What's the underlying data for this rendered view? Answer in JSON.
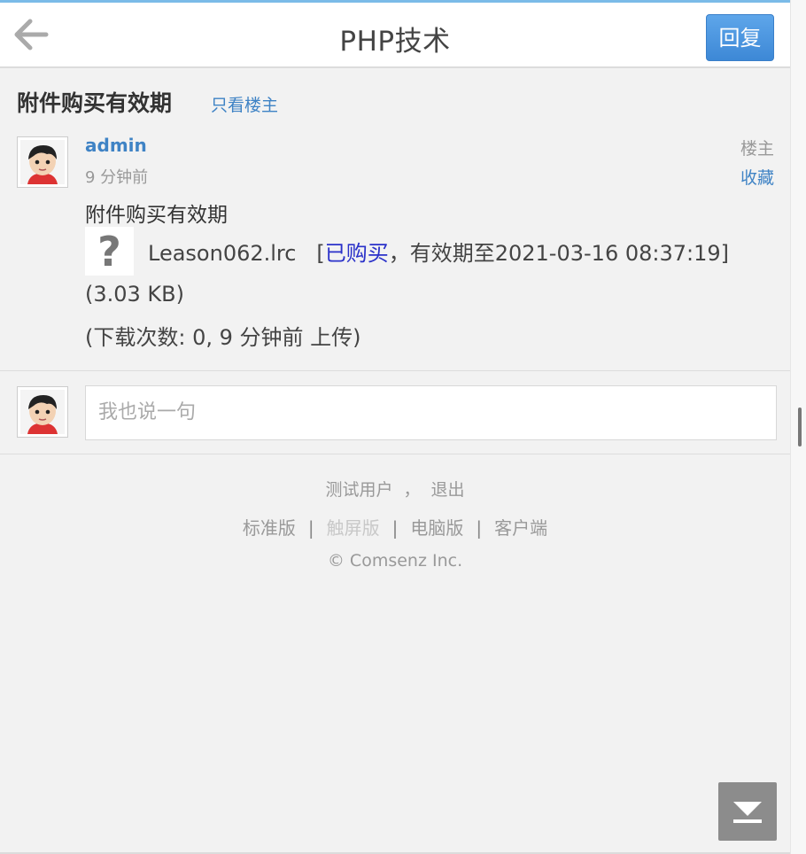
{
  "header": {
    "back_icon": "arrow-left-icon",
    "title": "PHP技术",
    "reply_label": "回复"
  },
  "thread": {
    "title": "附件购买有效期",
    "only_op_label": "只看楼主"
  },
  "post": {
    "author": "admin",
    "time": "9 分钟前",
    "floor_label": "楼主",
    "favorite_label": "收藏",
    "message": "附件购买有效期",
    "attachment": {
      "icon": "unknown-file-icon",
      "filename": "Leason062.lrc",
      "status_open": "[",
      "status_bought": "已购买",
      "status_rest": "，有效期至2021-03-16 08:37:19]",
      "size": "(3.03 KB)",
      "downloads": "(下载次数: 0, 9 分钟前 上传)"
    }
  },
  "comment": {
    "placeholder": "我也说一句"
  },
  "footer": {
    "username": "测试用户",
    "separator": "，",
    "logout": "退出",
    "links": [
      "标准版",
      "触屏版",
      "电脑版",
      "客户端"
    ],
    "link_separator": "|",
    "copyright": "© Comsenz Inc."
  },
  "scroll_icon": "scroll-to-bottom-icon",
  "colors": {
    "accent": "#3f83c5",
    "reply_button": "#4a93df",
    "bought": "#2a31c9"
  }
}
